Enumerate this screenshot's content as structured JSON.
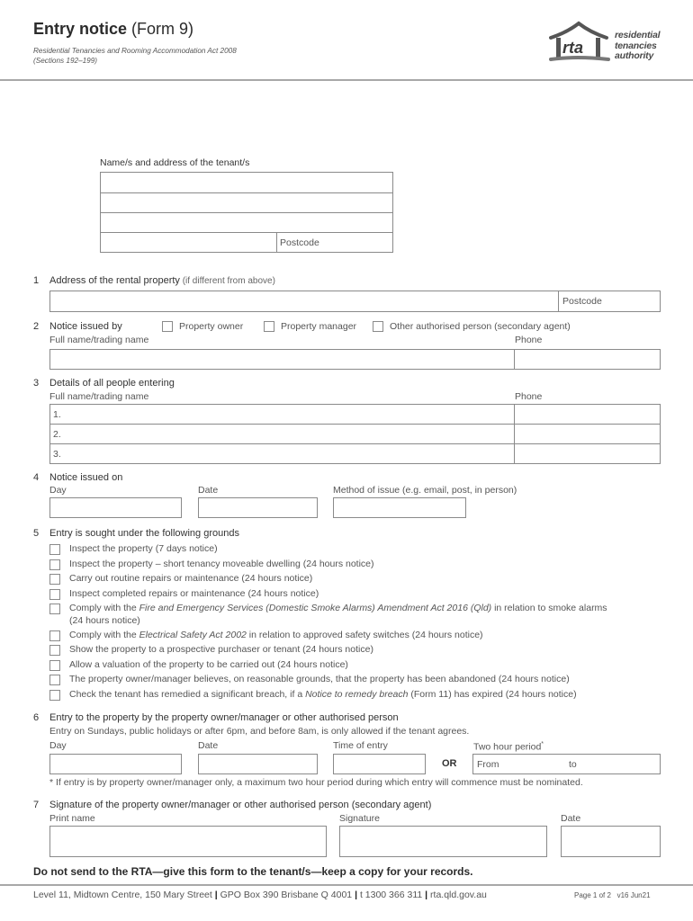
{
  "header": {
    "title_bold": "Entry notice",
    "title_light": " (Form 9)",
    "subtitle_line1": "Residential Tenancies and Rooming Accommodation Act 2008",
    "subtitle_line2": "(Sections 192–199)",
    "logo": {
      "mark_text": "rta",
      "line1": "residential",
      "line2": "tenancies",
      "line3": "authority"
    }
  },
  "tenant": {
    "label": "Name/s and address of the tenant/s",
    "postcode_label": "Postcode"
  },
  "sections": {
    "s1": {
      "num": "1",
      "title": "Address of the rental property",
      "note": " (if different from above)",
      "postcode_label": "Postcode"
    },
    "s2": {
      "num": "2",
      "title": "Notice issued by",
      "options": [
        "Property owner",
        "Property manager",
        "Other authorised person (secondary agent)"
      ],
      "name_label": "Full name/trading name",
      "phone_label": "Phone"
    },
    "s3": {
      "num": "3",
      "title": "Details of all people entering",
      "name_label": "Full name/trading name",
      "phone_label": "Phone",
      "rows": [
        "1.",
        "2.",
        "3."
      ]
    },
    "s4": {
      "num": "4",
      "title": "Notice issued on",
      "day_label": "Day",
      "date_label": "Date",
      "method_label": "Method of issue (e.g. email, post, in person)"
    },
    "s5": {
      "num": "5",
      "title": "Entry is sought under the following grounds",
      "grounds": [
        {
          "pre": "Inspect the property (7 days notice)",
          "ital": "",
          "post": ""
        },
        {
          "pre": "Inspect the property – short tenancy moveable dwelling (24 hours notice)",
          "ital": "",
          "post": ""
        },
        {
          "pre": "Carry out routine repairs or maintenance (24 hours notice)",
          "ital": "",
          "post": ""
        },
        {
          "pre": "Inspect completed repairs or maintenance (24 hours notice)",
          "ital": "",
          "post": ""
        },
        {
          "pre": "Comply with the ",
          "ital": "Fire and Emergency Services (Domestic Smoke Alarms) Amendment Act 2016 (Qld)",
          "post": " in relation to smoke alarms",
          "line2": "(24 hours notice)"
        },
        {
          "pre": "Comply with the ",
          "ital": "Electrical Safety Act 2002",
          "post": " in relation to approved safety switches (24 hours notice)"
        },
        {
          "pre": "Show the property to a prospective purchaser or tenant (24 hours notice)",
          "ital": "",
          "post": ""
        },
        {
          "pre": "Allow a valuation of the property to be carried out (24 hours notice)",
          "ital": "",
          "post": ""
        },
        {
          "pre": "The property owner/manager believes, on reasonable grounds, that the property has been abandoned (24 hours notice)",
          "ital": "",
          "post": ""
        },
        {
          "pre": "Check the tenant has remedied a significant breach, if a ",
          "ital": "Notice to remedy breach",
          "post": " (Form 11) has expired (24 hours notice)"
        }
      ]
    },
    "s6": {
      "num": "6",
      "title": "Entry to the property by the property owner/manager or other authorised person",
      "subtitle": "Entry on Sundays, public holidays or after 6pm, and before 8am, is only allowed if the tenant agrees.",
      "day_label": "Day",
      "date_label": "Date",
      "time_label": "Time of entry",
      "or_label": "OR",
      "period_label": "Two hour period",
      "period_asterisk": "*",
      "from_label": "From",
      "to_label": "to",
      "footnote": "* If entry is by property owner/manager only, a maximum two hour period during which entry will commence must be nominated."
    },
    "s7": {
      "num": "7",
      "title": "Signature of the property owner/manager or other authorised person (secondary agent)",
      "print_label": "Print name",
      "signature_label": "Signature",
      "date_label": "Date"
    }
  },
  "footer": {
    "notice": "Do not send to the RTA—give this form to the tenant/s—keep a copy for your records.",
    "address": "Level 11, Midtown Centre, 150 Mary Street",
    "sep": "|",
    "po_box": "GPO Box 390 Brisbane Q 4001",
    "phone": "t 1300 366 311",
    "website": "rta.qld.gov.au",
    "page": "Page 1 of 2",
    "version": "v16 Jun21"
  }
}
